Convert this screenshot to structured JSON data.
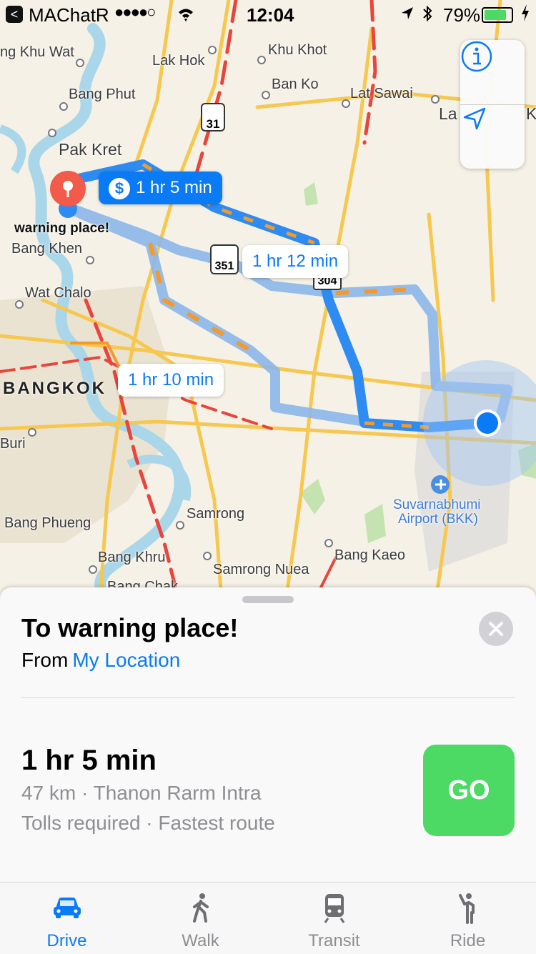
{
  "status_bar": {
    "back_glyph": "<",
    "carrier": "MAChatR",
    "signal_dots": "●●●●○",
    "time": "12:04",
    "battery": "79%",
    "battery_level": 0.79
  },
  "map": {
    "place_labels": [
      "ng Khu Wat",
      "Lak Hok",
      "Khu Khot",
      "Bang Phut",
      "Ban Ko",
      "Lat Sawai",
      "La",
      "Ka",
      "Pak Kret",
      "Bang Khen",
      "Wat Chalo",
      "BANGKOK",
      "Buri",
      "Samrong",
      "Bang Phueng",
      "Bang Khru",
      "Samrong Nuea",
      "Bang Kaeo",
      "Bang Chak",
      "Suvarnabhumi",
      "Airport (BKK)"
    ],
    "destination_label": "warning place!",
    "route_shields": [
      "31",
      "351",
      "304"
    ],
    "route_bubbles": {
      "primary": "1 hr 5 min",
      "primary_icon": "$",
      "alt1": "1 hr 12 min",
      "alt2": "1 hr 10 min"
    },
    "accent": "#0a7bf5"
  },
  "map_controls": {
    "info_icon": "info-icon",
    "locate_icon": "location-arrow-icon"
  },
  "sheet": {
    "title": "To warning place!",
    "from_prefix": "From",
    "from_link": "My Location",
    "route_time": "1 hr 5 min",
    "route_info": "47 km · Thanon Rarm Intra",
    "route_notes": "Tolls required · Fastest route",
    "go_label": "GO",
    "go_color": "#4cd964"
  },
  "tabs": [
    {
      "label": "Drive",
      "icon": "car-icon",
      "active": true
    },
    {
      "label": "Walk",
      "icon": "walk-icon",
      "active": false
    },
    {
      "label": "Transit",
      "icon": "train-icon",
      "active": false
    },
    {
      "label": "Ride",
      "icon": "ride-icon",
      "active": false
    }
  ]
}
